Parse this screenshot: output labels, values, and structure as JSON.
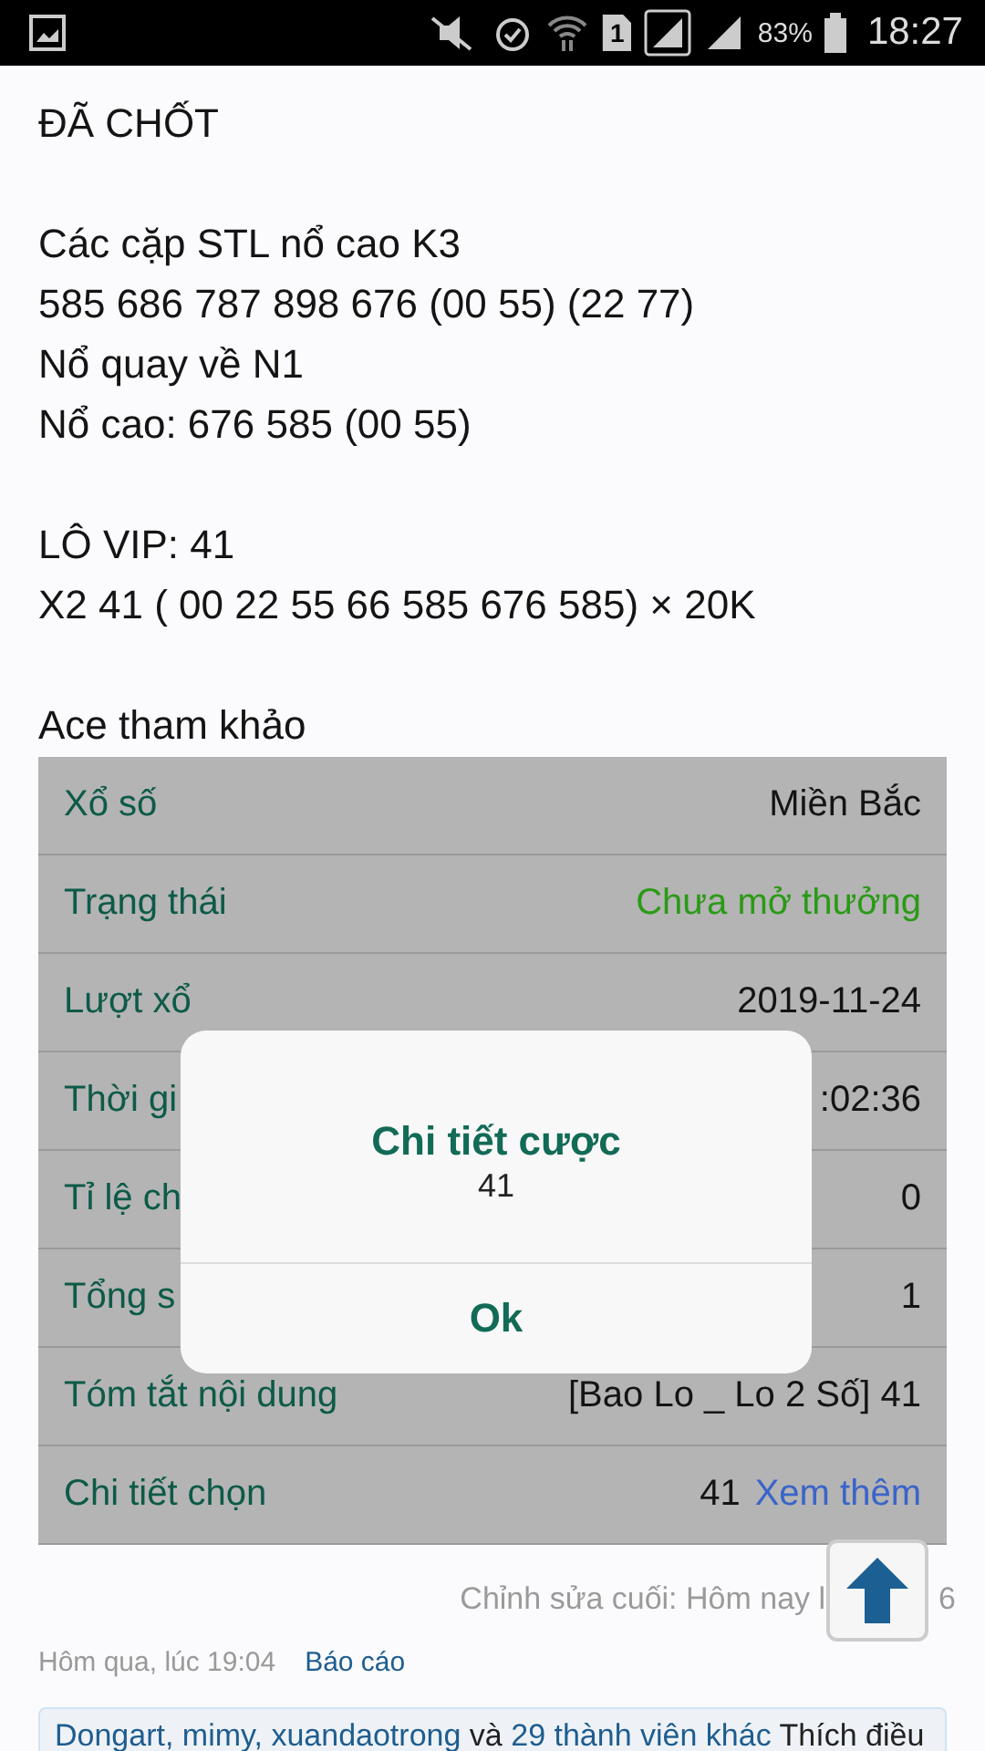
{
  "status_bar": {
    "battery_text": "83%",
    "time": "18:27",
    "sim_label": "1"
  },
  "post": {
    "paragraphs": [
      [
        "ĐÃ CHỐT"
      ],
      [
        "Các cặp STL nổ cao K3",
        "585 686 787 898 676 (00 55) (22 77)",
        "Nổ quay về N1",
        "Nổ cao: 676 585 (00 55)"
      ],
      [
        "LÔ VIP: 41",
        "X2 41 ( 00 22 55 66 585 676 585) × 20K"
      ],
      [
        "Ace tham khảo"
      ]
    ]
  },
  "table": {
    "rows": [
      {
        "kind": "text",
        "label": "Xổ số",
        "value": "Miền Bắc"
      },
      {
        "kind": "status",
        "label": "Trạng thái",
        "value": "Chưa mở thưởng"
      },
      {
        "kind": "text",
        "label": "Lượt xổ",
        "value": "2019-11-24"
      },
      {
        "kind": "text",
        "label": "Thời gi",
        "value": ":02:36"
      },
      {
        "kind": "text",
        "label": "Tỉ lệ ch",
        "value": "0"
      },
      {
        "kind": "text",
        "label": "Tổng s",
        "value": "1"
      },
      {
        "kind": "text",
        "label": "Tóm tắt nội dung",
        "value": "[Bao Lo _ Lo 2 Số] 41"
      },
      {
        "kind": "detail",
        "label": "Chi tiết chọn",
        "value": "41",
        "link": "Xem thêm"
      }
    ]
  },
  "dialog": {
    "title": "Chi tiết cược",
    "message": "41",
    "button": "Ok"
  },
  "footer": {
    "edited_text": "Chỉnh sửa cuối: Hôm nay l",
    "edited_tail": "6",
    "time": "Hôm qua, lúc 19:04",
    "report_link": "Báo cáo",
    "likes": {
      "users_link": "Dongart, mimy, xuandaotrong",
      "joiner": "và",
      "others_link": "29 thành viên khác",
      "text": "Thích điều"
    }
  }
}
